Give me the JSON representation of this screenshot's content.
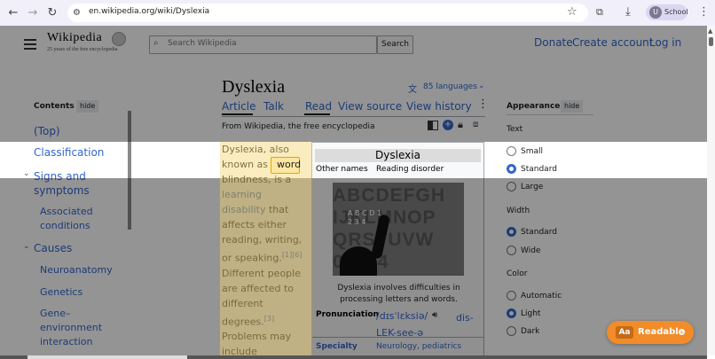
{
  "browser": {
    "url": "en.wikipedia.org/wiki/Dyslexia",
    "profile_initial": "U",
    "profile_name": "School"
  },
  "wiki": {
    "logo_title": "Wikipedia",
    "logo_tagline": "25 years of the free encyclopedia",
    "search_placeholder": "Search Wikipedia",
    "search_button": "Search",
    "donate": "Donate",
    "create_account": "Create account",
    "login": "Log in"
  },
  "article": {
    "title": "Dyslexia",
    "languages": "85 languages",
    "tabs": {
      "article": "Article",
      "talk": "Talk",
      "read": "Read",
      "view_source": "View source",
      "view_history": "View history"
    },
    "from_line": "From Wikipedia, the free encyclopedia",
    "body": {
      "p1": "Dyslexia, also known as",
      "word": "word",
      "p2": "blindness",
      "p3": ", is a",
      "link1": "learning disability",
      "p4": "that affects either reading, writing, or speaking.",
      "ref1": "[1][6]",
      "p5": "Different people are affected to different degrees.",
      "ref2": "[3]",
      "p6": "Problems may include"
    }
  },
  "contents": {
    "heading": "Contents",
    "hide": "hide",
    "items": [
      "(Top)",
      "Classification",
      "Signs and symptoms",
      "Associated conditions",
      "Causes",
      "Neuroanatomy",
      "Genetics",
      "Gene–environment interaction"
    ]
  },
  "infobox": {
    "title": "Dyslexia",
    "other_names_label": "Other names",
    "other_names_value": "Reading disorder",
    "image_letters": "ABCDEFGH IJKLMNOP QRSTUVW 01234",
    "image_chalk": "A B C D 1 2 3 4",
    "caption": "Dyslexia involves difficulties in processing letters and words.",
    "pronunciation_label": "Pronunciation",
    "pronunciation_ipa": "/dɪsˈlɛksiə/",
    "pronunciation_respell": "dis-LEK-see-ə",
    "specialty_label": "Specialty",
    "specialty_value": "Neurology, pediatrics"
  },
  "appearance": {
    "heading": "Appearance",
    "hide": "hide",
    "text_label": "Text",
    "text_options": [
      "Small",
      "Standard",
      "Large"
    ],
    "text_selected": "Standard",
    "width_label": "Width",
    "width_options": [
      "Standard",
      "Wide"
    ],
    "width_selected": "Standard",
    "color_label": "Color",
    "color_options": [
      "Automatic",
      "Light",
      "Dark"
    ],
    "color_selected": "Light"
  },
  "readable": {
    "badge": "Aa",
    "label": "Readable"
  },
  "colors": {
    "link": "#3366cc",
    "overlay_accent": "#f28c28",
    "highlight": "#fde7a0"
  }
}
